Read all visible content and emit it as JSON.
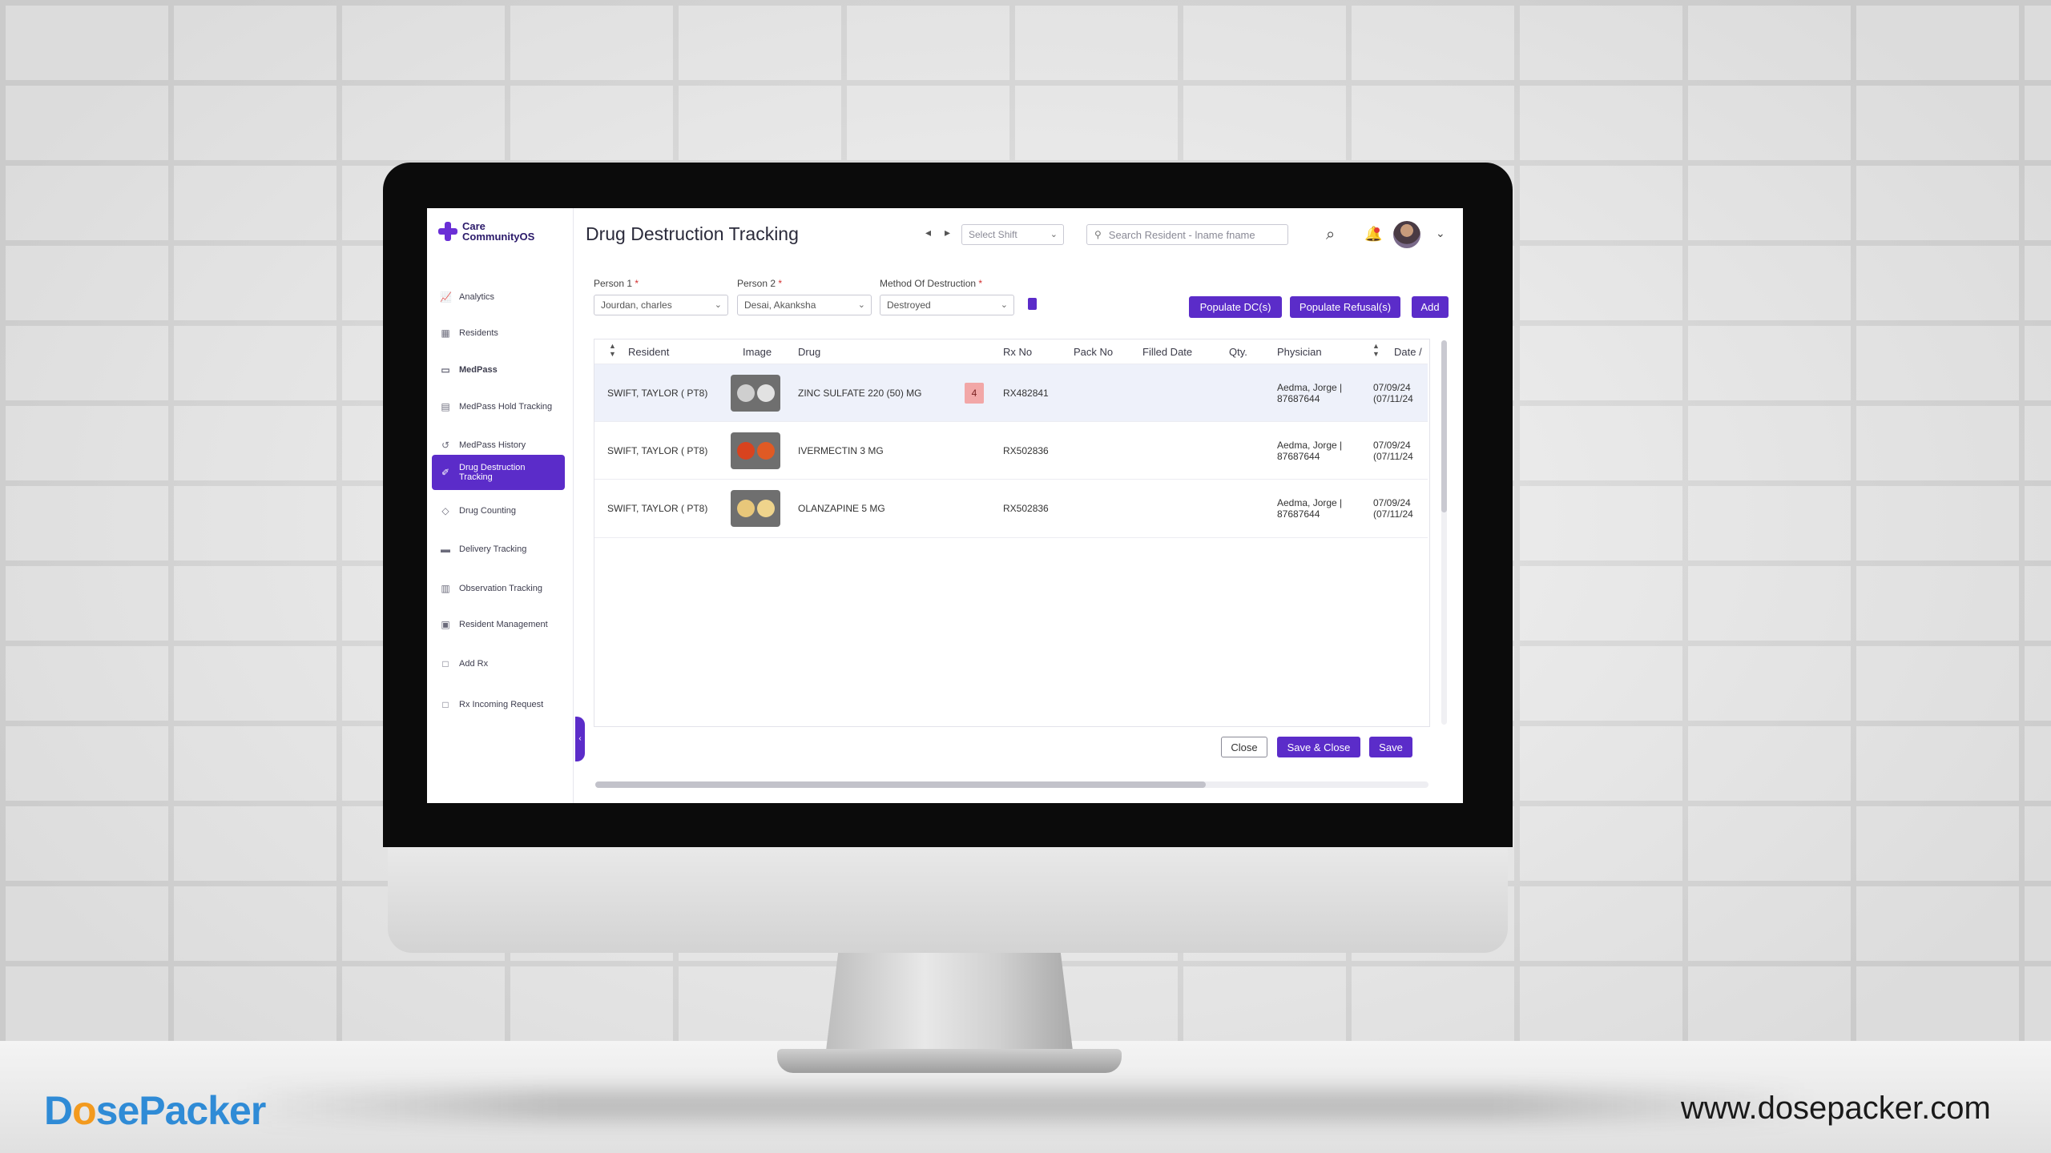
{
  "sidebar": {
    "logo_line1": "Care",
    "logo_line2": "CommunityOS",
    "items": [
      {
        "label": "Analytics",
        "icon": "chart-line-icon"
      },
      {
        "label": "Residents",
        "icon": "grid-icon"
      },
      {
        "label": "MedPass",
        "icon": "pill-icon"
      },
      {
        "label": "MedPass Hold Tracking",
        "icon": "document-icon"
      },
      {
        "label": "MedPass History",
        "icon": "history-icon"
      },
      {
        "label": "Drug Destruction Tracking",
        "icon": "eraser-icon"
      },
      {
        "label": "Drug Counting",
        "icon": "tag-icon"
      },
      {
        "label": "Delivery Tracking",
        "icon": "truck-icon"
      },
      {
        "label": "Observation Tracking",
        "icon": "observation-icon"
      },
      {
        "label": "Resident Management",
        "icon": "user-square-icon"
      },
      {
        "label": "Add Rx",
        "icon": "file-add-icon"
      },
      {
        "label": "Rx Incoming Request",
        "icon": "file-inbox-icon"
      }
    ]
  },
  "header": {
    "title": "Drug Destruction Tracking",
    "shift_select": "Select Shift",
    "search_placeholder": "Search Resident - lname fname"
  },
  "form": {
    "person1_label": "Person 1",
    "person1_value": "Jourdan, charles",
    "person2_label": "Person 2",
    "person2_value": "Desai, Akanksha",
    "method_label": "Method Of Destruction",
    "method_value": "Destroyed",
    "required_mark": "*",
    "populate_dc": "Populate DC(s)",
    "populate_refusal": "Populate Refusal(s)",
    "add": "Add"
  },
  "table": {
    "columns": [
      "Resident",
      "Image",
      "Drug",
      "Rx No",
      "Pack No",
      "Filled Date",
      "Qty.",
      "Physician",
      "Date /"
    ],
    "rows": [
      {
        "resident": "SWIFT, TAYLOR ( PT8)",
        "drug": "ZINC SULFATE 220 (50) MG",
        "badge": "4",
        "rx_no": "RX482841",
        "physician_1": "Aedma, Jorge |",
        "physician_2": "87687644",
        "date_1": "07/09/24",
        "date_2": "(07/11/24",
        "pill_colors": [
          "#cfcfcf",
          "#e2e2e2"
        ]
      },
      {
        "resident": "SWIFT, TAYLOR ( PT8)",
        "drug": "IVERMECTIN 3 MG",
        "badge": "",
        "rx_no": "RX502836",
        "physician_1": "Aedma, Jorge |",
        "physician_2": "87687644",
        "date_1": "07/09/24",
        "date_2": "(07/11/24",
        "pill_colors": [
          "#d8431f",
          "#e05a24"
        ]
      },
      {
        "resident": "SWIFT, TAYLOR ( PT8)",
        "drug": "OLANZAPINE 5 MG",
        "badge": "",
        "rx_no": "RX502836",
        "physician_1": "Aedma, Jorge |",
        "physician_2": "87687644",
        "date_1": "07/09/24",
        "date_2": "(07/11/24",
        "pill_colors": [
          "#e8c77a",
          "#efd48c"
        ]
      }
    ]
  },
  "footer": {
    "close": "Close",
    "save_close": "Save & Close",
    "save": "Save"
  },
  "watermark": {
    "brand_d": "D",
    "brand_o": "o",
    "brand_rest": "sePacker",
    "url": "www.dosepacker.com"
  },
  "colors": {
    "accent": "#5b2cc9",
    "badge_bg": "#f2a7a7",
    "required": "#d32f2f"
  }
}
